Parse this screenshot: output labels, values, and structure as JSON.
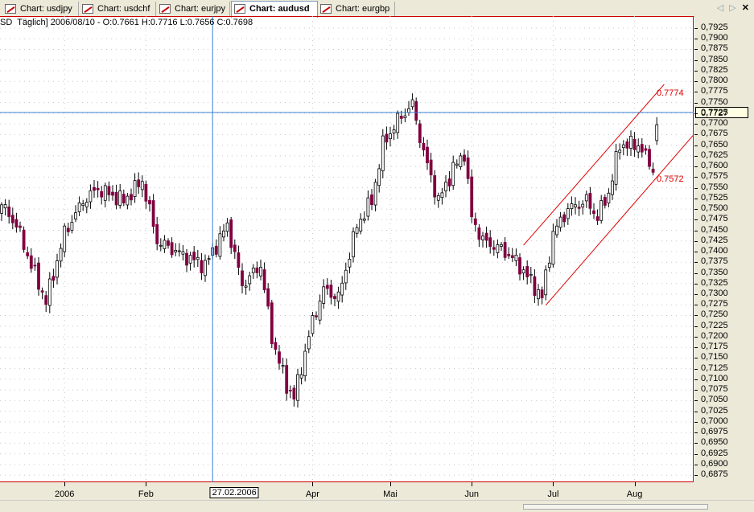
{
  "tabs": [
    {
      "label": "Chart: usdjpy",
      "active": false
    },
    {
      "label": "Chart: usdchf",
      "active": false
    },
    {
      "label": "Chart: eurjpy",
      "active": false
    },
    {
      "label": "Chart: audusd",
      "active": true
    },
    {
      "label": "Chart: eurgbp",
      "active": false
    }
  ],
  "nav": {
    "prev": "◁",
    "next": "▷",
    "close": "✕"
  },
  "header": "SD  Täglich] 2006/08/10 - O:0.7661 H:0.7716 L:0.7656 C:0.7698",
  "chart_data": {
    "type": "candlestick",
    "symbol": "audusd",
    "ylim": [
      0.6875,
      0.7925
    ],
    "y_ticks": [
      "0,7925",
      "0,7900",
      "0,7875",
      "0,7850",
      "0,7825",
      "0,7800",
      "0,7775",
      "0,7750",
      "0,7725",
      "0,7700",
      "0,7675",
      "0,7650",
      "0,7625",
      "0,7600",
      "0,7575",
      "0,7550",
      "0,7525",
      "0,7500",
      "0,7475",
      "0,7450",
      "0,7425",
      "0,7400",
      "0,7375",
      "0,7350",
      "0,7325",
      "0,7300",
      "0,7275",
      "0,7250",
      "0,7225",
      "0,7200",
      "0,7175",
      "0,7150",
      "0,7125",
      "0,7100",
      "0,7075",
      "0,7050",
      "0,7025",
      "0,7000",
      "0,6975",
      "0,6950",
      "0,6925",
      "0,6900",
      "0,6875"
    ],
    "x_ticks": [
      {
        "label": "2006",
        "index": 17
      },
      {
        "label": "Feb",
        "index": 39
      },
      {
        "label": "Apr",
        "index": 84
      },
      {
        "label": "Mai",
        "index": 105
      },
      {
        "label": "Jun",
        "index": 127
      },
      {
        "label": "Jul",
        "index": 149
      },
      {
        "label": "Aug",
        "index": 171
      }
    ],
    "n_candles": 178,
    "close_keypoints": [
      [
        0,
        0.751
      ],
      [
        4,
        0.7462
      ],
      [
        8,
        0.7368
      ],
      [
        12,
        0.7283
      ],
      [
        17,
        0.7443
      ],
      [
        22,
        0.7519
      ],
      [
        26,
        0.7547
      ],
      [
        33,
        0.7519
      ],
      [
        38,
        0.7566
      ],
      [
        42,
        0.7425
      ],
      [
        50,
        0.7387
      ],
      [
        55,
        0.7368
      ],
      [
        61,
        0.7462
      ],
      [
        65,
        0.7321
      ],
      [
        70,
        0.7368
      ],
      [
        73,
        0.7198
      ],
      [
        77,
        0.7085
      ],
      [
        79,
        0.7057
      ],
      [
        84,
        0.7236
      ],
      [
        87,
        0.7311
      ],
      [
        91,
        0.7292
      ],
      [
        96,
        0.7462
      ],
      [
        100,
        0.7519
      ],
      [
        103,
        0.7651
      ],
      [
        107,
        0.7708
      ],
      [
        111,
        0.7746
      ],
      [
        114,
        0.7632
      ],
      [
        118,
        0.7519
      ],
      [
        122,
        0.7594
      ],
      [
        125,
        0.7632
      ],
      [
        127,
        0.7481
      ],
      [
        130,
        0.7425
      ],
      [
        135,
        0.7406
      ],
      [
        139,
        0.7377
      ],
      [
        143,
        0.733
      ],
      [
        146,
        0.7292
      ],
      [
        149,
        0.7443
      ],
      [
        153,
        0.75
      ],
      [
        158,
        0.7519
      ],
      [
        161,
        0.7481
      ],
      [
        164,
        0.7538
      ],
      [
        167,
        0.7651
      ],
      [
        172,
        0.7651
      ],
      [
        176,
        0.7594
      ],
      [
        177,
        0.7698
      ]
    ],
    "last_candle": {
      "date": "2006/08/10",
      "open": 0.7661,
      "high": 0.7716,
      "low": 0.7656,
      "close": 0.7698
    },
    "channel": {
      "upper": {
        "from": [
          141,
          0.7415
        ],
        "to": [
          179,
          0.7793
        ],
        "label": "0.7774",
        "label_price": 0.7774
      },
      "lower": {
        "from": [
          147,
          0.7274
        ],
        "to": [
          189,
          0.7695
        ],
        "label": "0.7572",
        "label_price": 0.7572
      }
    },
    "crosshair": {
      "date": "27.02.2006",
      "index": 57,
      "price": "0,7727",
      "price_value": 0.7727
    },
    "colors": {
      "bear": "#800040",
      "bull": "#ffffff",
      "wick": "#000000",
      "channel": "#e00000",
      "crosshair": "#3a7fd5",
      "grid": "#c8c8c8"
    }
  }
}
